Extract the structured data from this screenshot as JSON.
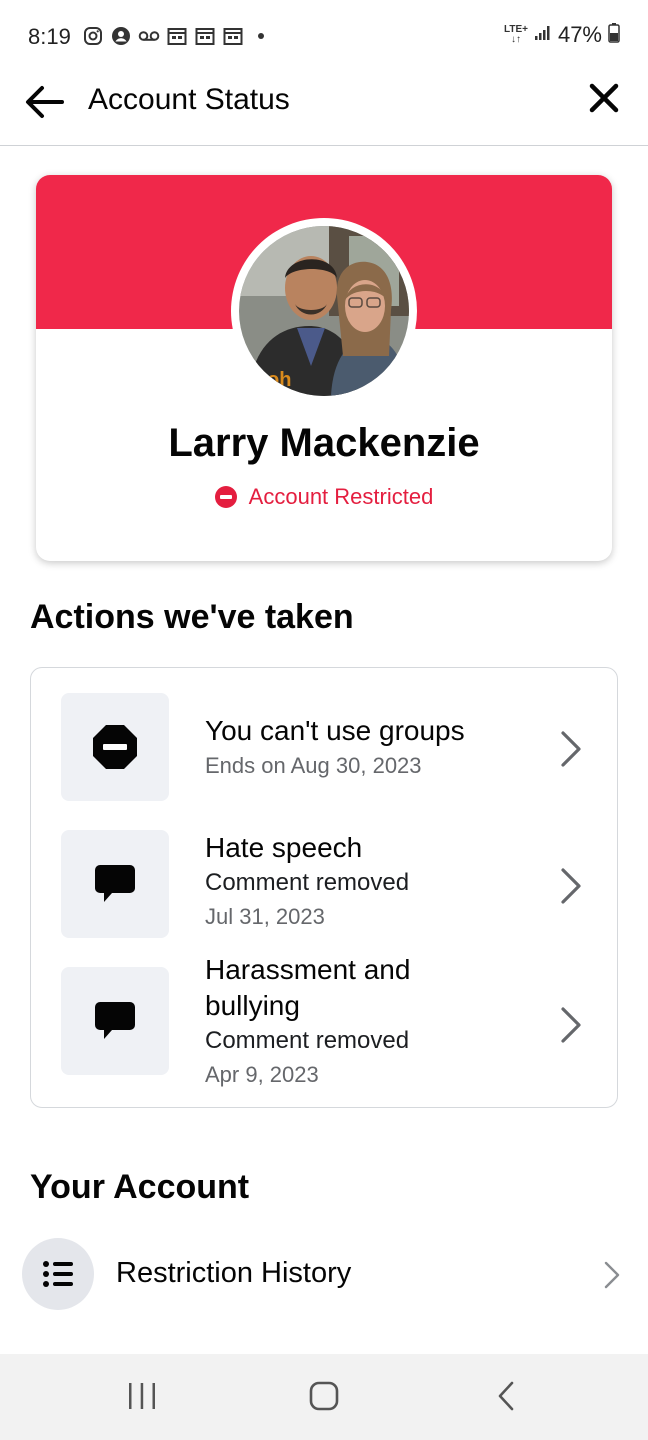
{
  "status_bar": {
    "time": "8:19",
    "network": "LTE+",
    "battery": "47%"
  },
  "header": {
    "title": "Account Status"
  },
  "profile": {
    "name": "Larry Mackenzie",
    "status": "Account Restricted",
    "banner_color": "#f0284a",
    "status_color": "#e41e3f"
  },
  "actions": {
    "title": "Actions we've taken",
    "items": [
      {
        "icon": "restricted-icon",
        "title": "You can't use groups",
        "subtitle": "Ends on Aug 30, 2023",
        "date": ""
      },
      {
        "icon": "comment-icon",
        "title": "Hate speech",
        "subtitle": "Comment removed",
        "date": "Jul 31, 2023"
      },
      {
        "icon": "comment-icon",
        "title": "Harassment and bullying",
        "subtitle": "Comment removed",
        "date": "Apr 9, 2023"
      }
    ]
  },
  "your_account": {
    "title": "Your Account",
    "history_label": "Restriction History"
  }
}
